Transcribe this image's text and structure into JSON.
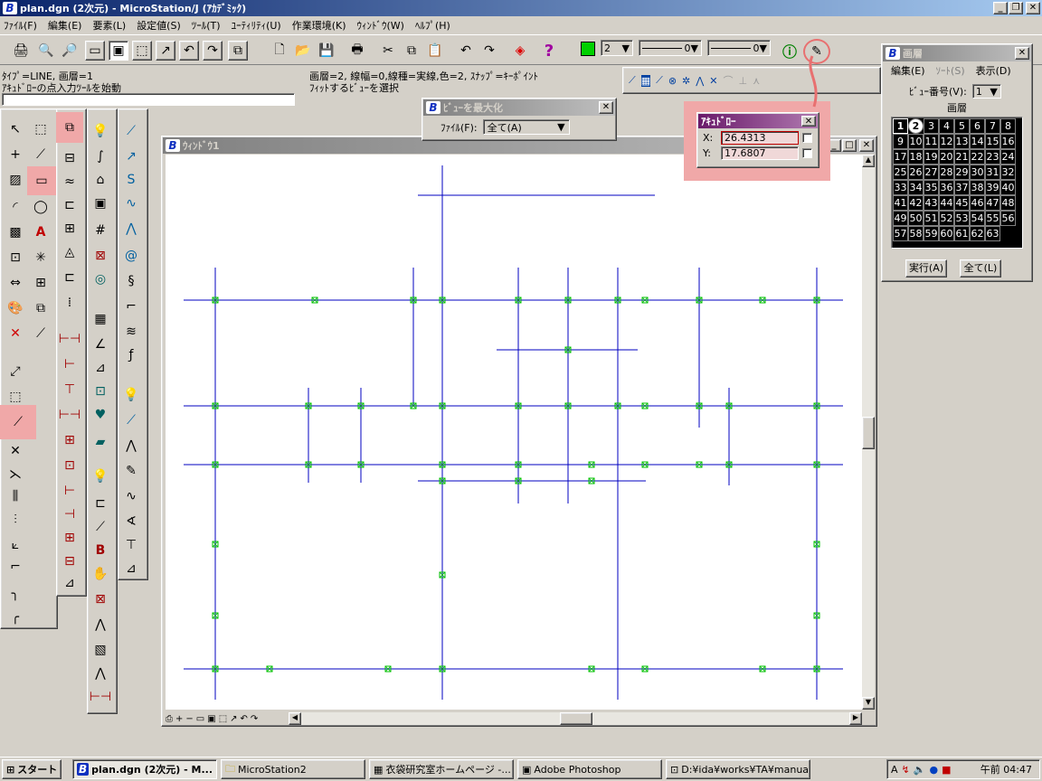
{
  "window": {
    "title": "plan.dgn (2次元) - MicroStation/J (ｱｶﾃﾞﾐｯｸ)"
  },
  "menu": [
    "ﾌｧｲﾙ(F)",
    "編集(E)",
    "要素(L)",
    "設定値(S)",
    "ﾂｰﾙ(T)",
    "ﾕｰﾃｨﾘﾃｨ(U)",
    "作業環境(K)",
    "ｳｨﾝﾄﾞｳ(W)",
    "ﾍﾙﾌﾟ(H)"
  ],
  "attributes": {
    "level_value": "2",
    "line_style_value": "0",
    "line_weight_value": "0"
  },
  "status": {
    "line1": "ﾀｲﾌﾟ=LINE, 画層=1",
    "line2": "ｱｷｭﾄﾞﾛｰの点入力ﾂｰﾙを始動",
    "right1": "画層=2, 線幅=0,線種=実線,色=2, ｽﾅｯﾌﾟ=ｷｰﾎﾟｲﾝﾄ",
    "right2": "ﾌｨｯﾄするﾋﾞｭｰを選択"
  },
  "fit_dialog": {
    "title": "ﾋﾞｭｰを最大化",
    "file_label": "ﾌｧｲﾙ(F):",
    "file_value": "全て(A)"
  },
  "accudraw": {
    "title": "ｱｷｭﾄﾞﾛｰ",
    "x_label": "X:",
    "x_value": "26.4313",
    "y_label": "Y:",
    "y_value": "17.6807"
  },
  "view_window": {
    "title": "ｳｨﾝﾄﾞｳ1"
  },
  "levels_panel": {
    "title": "画層",
    "menu": [
      "編集(E)",
      "ｿｰﾄ(S)",
      "表示(D)"
    ],
    "view_label": "ﾋﾞｭｰ番号(V):",
    "view_value": "1",
    "heading": "画層",
    "levels": [
      "1",
      "2",
      "3",
      "4",
      "5",
      "6",
      "7",
      "8",
      "9",
      "10",
      "11",
      "12",
      "13",
      "14",
      "15",
      "16",
      "17",
      "18",
      "19",
      "20",
      "21",
      "22",
      "23",
      "24",
      "25",
      "26",
      "27",
      "28",
      "29",
      "30",
      "31",
      "32",
      "33",
      "34",
      "35",
      "36",
      "37",
      "38",
      "39",
      "40",
      "41",
      "42",
      "43",
      "44",
      "45",
      "46",
      "47",
      "48",
      "49",
      "50",
      "51",
      "52",
      "53",
      "54",
      "55",
      "56",
      "57",
      "58",
      "59",
      "60",
      "61",
      "62",
      "63"
    ],
    "apply_button": "実行(A)",
    "all_button": "全て(L)"
  },
  "taskbar": {
    "start": "スタート",
    "tasks": [
      "plan.dgn (2次元) - M...",
      "MicroStation2",
      "衣袋研究室ホームページ -...",
      "Adobe Photoshop",
      "D:¥ida¥works¥TA¥manual..."
    ],
    "clock": "午前 04:47"
  },
  "colors": {
    "line": "#0000c0",
    "keypoint": "#00c000",
    "highlight": "#f0a8a8"
  }
}
